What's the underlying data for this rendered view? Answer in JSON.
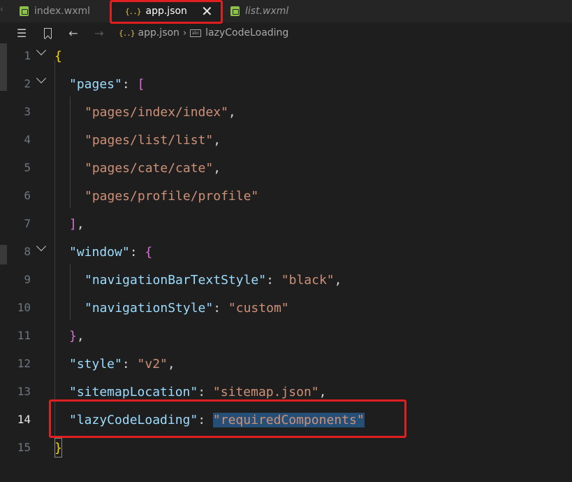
{
  "tabs": [
    {
      "label": "index.wxml",
      "active": false,
      "italic": false,
      "icon": "wxml-file-icon"
    },
    {
      "label": "app.json",
      "active": true,
      "italic": false,
      "icon": "json-braces-icon",
      "close": "✕"
    },
    {
      "label": "list.wxml",
      "active": false,
      "italic": true,
      "icon": "wxml-file-icon"
    }
  ],
  "breadcrumb": {
    "file": "app.json",
    "property": "lazyCodeLoading",
    "icons": [
      "list-icon",
      "bookmark-icon",
      "back-arrow-icon",
      "forward-arrow-icon",
      "json-braces-icon",
      "property-icon"
    ]
  },
  "editor": {
    "current_line": 14,
    "line_numbers": [
      "1",
      "2",
      "3",
      "4",
      "5",
      "6",
      "7",
      "8",
      "9",
      "10",
      "11",
      "12",
      "13",
      "14",
      "15"
    ],
    "lines": {
      "l1": {
        "open": "{"
      },
      "l2": {
        "key": "\"pages\"",
        "colon": ": ",
        "open": "["
      },
      "l3": {
        "value": "\"pages/index/index\"",
        "comma": ","
      },
      "l4": {
        "value": "\"pages/list/list\"",
        "comma": ","
      },
      "l5": {
        "value": "\"pages/cate/cate\"",
        "comma": ","
      },
      "l6": {
        "value": "\"pages/profile/profile\""
      },
      "l7": {
        "close": "]",
        "comma": ","
      },
      "l8": {
        "key": "\"window\"",
        "colon": ": ",
        "open": "{"
      },
      "l9": {
        "key": "\"navigationBarTextStyle\"",
        "colon": ": ",
        "value": "\"black\"",
        "comma": ","
      },
      "l10": {
        "key": "\"navigationStyle\"",
        "colon": ": ",
        "value": "\"custom\""
      },
      "l11": {
        "close": "}",
        "comma": ","
      },
      "l12": {
        "key": "\"style\"",
        "colon": ": ",
        "value": "\"v2\"",
        "comma": ","
      },
      "l13": {
        "key": "\"sitemapLocation\"",
        "colon": ": ",
        "value": "\"sitemap.json\"",
        "comma": ","
      },
      "l14": {
        "key": "\"lazyCodeLoading\"",
        "colon": ": ",
        "value": "\"requiredComponents\""
      },
      "l15": {
        "close": "}"
      }
    }
  },
  "colors": {
    "key": "#9cdcfe",
    "string": "#ce9178",
    "bracket_level1": "#ffd700",
    "bracket_level2": "#da70d6",
    "bracket_level3": "#179fff",
    "selection": "#264f78",
    "annotation": "#e02020"
  }
}
